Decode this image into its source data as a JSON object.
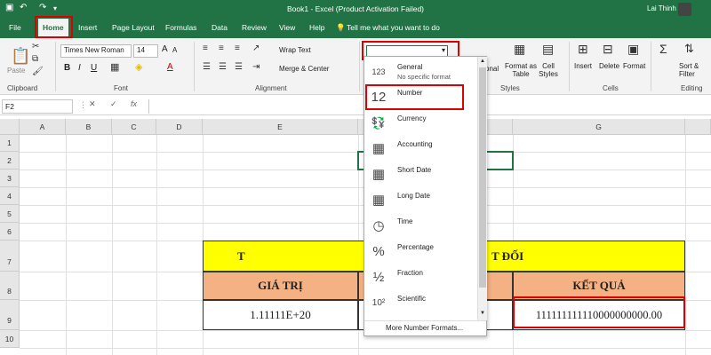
{
  "titlebar": {
    "undo": "↶",
    "redo": "↷",
    "title": "Book1  -  Excel (Product Activation Failed)",
    "user": "Lai Thinh"
  },
  "tabs": [
    "File",
    "Home",
    "Insert",
    "Page Layout",
    "Formulas",
    "Data",
    "Review",
    "View",
    "Help"
  ],
  "tell_me": "Tell me what you want to do",
  "ribbon": {
    "paste": "Paste",
    "clipboard": "Clipboard",
    "font_name": "Times New Roman",
    "font_size": "14",
    "font_group": "Font",
    "bold": "B",
    "italic": "I",
    "underline": "U",
    "font_grow": "A",
    "font_shrink": "A",
    "wrap_text": "Wrap Text",
    "merge_center": "Merge & Center",
    "alignment": "Alignment",
    "conditional": "onal",
    "format_as_table": "Format as Table",
    "cell_styles": "Cell Styles",
    "styles": "Styles",
    "insert": "Insert",
    "delete": "Delete",
    "format": "Format",
    "cells": "Cells",
    "sort_filter": "Sort & Filter",
    "editing": "Editing"
  },
  "formula_bar": {
    "name_box": "F2",
    "cancel": "✕",
    "enter": "✓",
    "fx": "fx",
    "formula": ""
  },
  "columns": [
    "A",
    "B",
    "C",
    "D",
    "E",
    "",
    "G"
  ],
  "rows": [
    "1",
    "2",
    "3",
    "4",
    "5",
    "6",
    "7",
    "8",
    "9",
    "10"
  ],
  "sheet": {
    "title_part1": "T",
    "title_part2": "T ĐỐI",
    "header_value": "GIÁ TRỊ",
    "header_result": "KẾT QUẢ",
    "value": "1.11111E+20",
    "result": "111111111110000000000.00"
  },
  "number_format_dropdown": {
    "items": [
      {
        "icon": "123",
        "label": "General",
        "sub": "No specific format"
      },
      {
        "icon": "12",
        "label": "Number",
        "sub": ""
      },
      {
        "icon": "💱",
        "label": "Currency",
        "sub": ""
      },
      {
        "icon": "▦",
        "label": "Accounting",
        "sub": ""
      },
      {
        "icon": "▦",
        "label": "Short Date",
        "sub": ""
      },
      {
        "icon": "▦",
        "label": "Long Date",
        "sub": ""
      },
      {
        "icon": "◷",
        "label": "Time",
        "sub": ""
      },
      {
        "icon": "%",
        "label": "Percentage",
        "sub": ""
      },
      {
        "icon": "½",
        "label": "Fraction",
        "sub": ""
      },
      {
        "icon": "10²",
        "label": "Scientific",
        "sub": ""
      }
    ],
    "more": "More Number Formats..."
  },
  "colors": {
    "excel_green": "#217346",
    "title_fill": "#ffff00",
    "header_fill": "#f4b183",
    "highlight": "#dd0000"
  }
}
